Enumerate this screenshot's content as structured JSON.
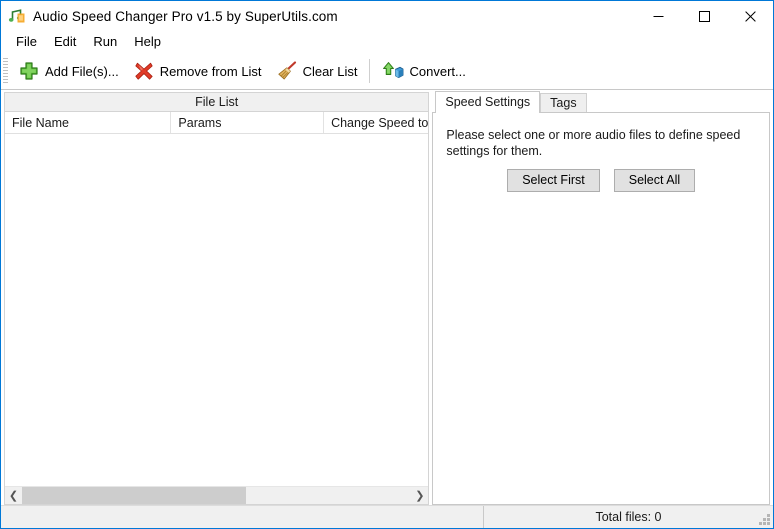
{
  "window": {
    "title": "Audio Speed Changer Pro v1.5 by SuperUtils.com",
    "app_icon": "music-note-icon",
    "controls": {
      "minimize": "–",
      "maximize": "☐",
      "close": "✕"
    },
    "accent_border": "#0078d7"
  },
  "menubar": {
    "items": [
      {
        "label": "File"
      },
      {
        "label": "Edit"
      },
      {
        "label": "Run"
      },
      {
        "label": "Help"
      }
    ]
  },
  "toolbar": {
    "buttons": [
      {
        "label": "Add File(s)...",
        "icon": "plus-icon"
      },
      {
        "label": "Remove from List",
        "icon": "x-mark-icon"
      },
      {
        "label": "Clear List",
        "icon": "broom-icon"
      },
      {
        "label": "Convert...",
        "icon": "convert-arrow-cube-icon"
      }
    ]
  },
  "file_list": {
    "caption": "File List",
    "columns": [
      "File Name",
      "Params",
      "Change Speed to"
    ],
    "rows": [],
    "scrollbar": {
      "left_arrow": "❮",
      "right_arrow": "❯"
    }
  },
  "side_panel": {
    "tabs": [
      {
        "label": "Speed Settings",
        "active": true
      },
      {
        "label": "Tags",
        "active": false
      }
    ],
    "speed_settings": {
      "hint": "Please select one or more audio files to define speed settings for them.",
      "buttons": [
        {
          "label": "Select First"
        },
        {
          "label": "Select All"
        }
      ]
    }
  },
  "statusbar": {
    "left_text": "",
    "total_files": "Total files: 0"
  }
}
